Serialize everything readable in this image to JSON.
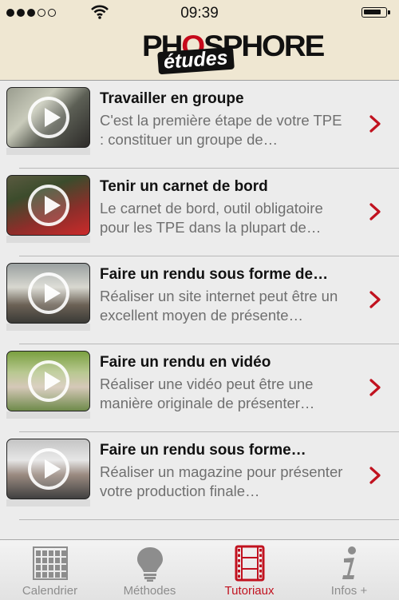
{
  "status_bar": {
    "time": "09:39",
    "signal_bars": 3,
    "signal_total": 5,
    "battery_level": 0.85,
    "icons": [
      "signal-dots",
      "wifi-icon",
      "battery-icon"
    ]
  },
  "header": {
    "logo_text": "PHOSPHORE",
    "logo_subtext": "études"
  },
  "colors": {
    "accent": "#c1121f",
    "header_bg": "#efe7d2",
    "list_bg": "#ececec",
    "title": "#111111",
    "description": "#6f6f6f"
  },
  "tutorials": [
    {
      "title": "Travailler en groupe",
      "description": "C'est la première étape de votre TPE : constituer un groupe de…",
      "icons": [
        "play-icon",
        "chevron-right-icon"
      ]
    },
    {
      "title": "Tenir un carnet de bord",
      "description": "Le carnet de bord, outil obligatoire pour les TPE dans la plupart de…",
      "icons": [
        "play-icon",
        "chevron-right-icon"
      ]
    },
    {
      "title": "Faire un rendu sous forme de…",
      "description": "Réaliser un site internet peut être un excellent moyen de présente…",
      "icons": [
        "play-icon",
        "chevron-right-icon"
      ]
    },
    {
      "title": "Faire un rendu en vidéo",
      "description": "Réaliser une vidéo peut être une manière originale de présenter…",
      "icons": [
        "play-icon",
        "chevron-right-icon"
      ]
    },
    {
      "title": "Faire un rendu sous forme…",
      "description": "Réaliser un magazine pour présenter votre production finale…",
      "icons": [
        "play-icon",
        "chevron-right-icon"
      ]
    }
  ],
  "tabs": [
    {
      "label": "Calendrier",
      "icon": "calendar-grid-icon",
      "active": false
    },
    {
      "label": "Méthodes",
      "icon": "lightbulb-icon",
      "active": false
    },
    {
      "label": "Tutoriaux",
      "icon": "film-strip-icon",
      "active": true
    },
    {
      "label": "Infos +",
      "icon": "info-icon",
      "active": false
    }
  ]
}
